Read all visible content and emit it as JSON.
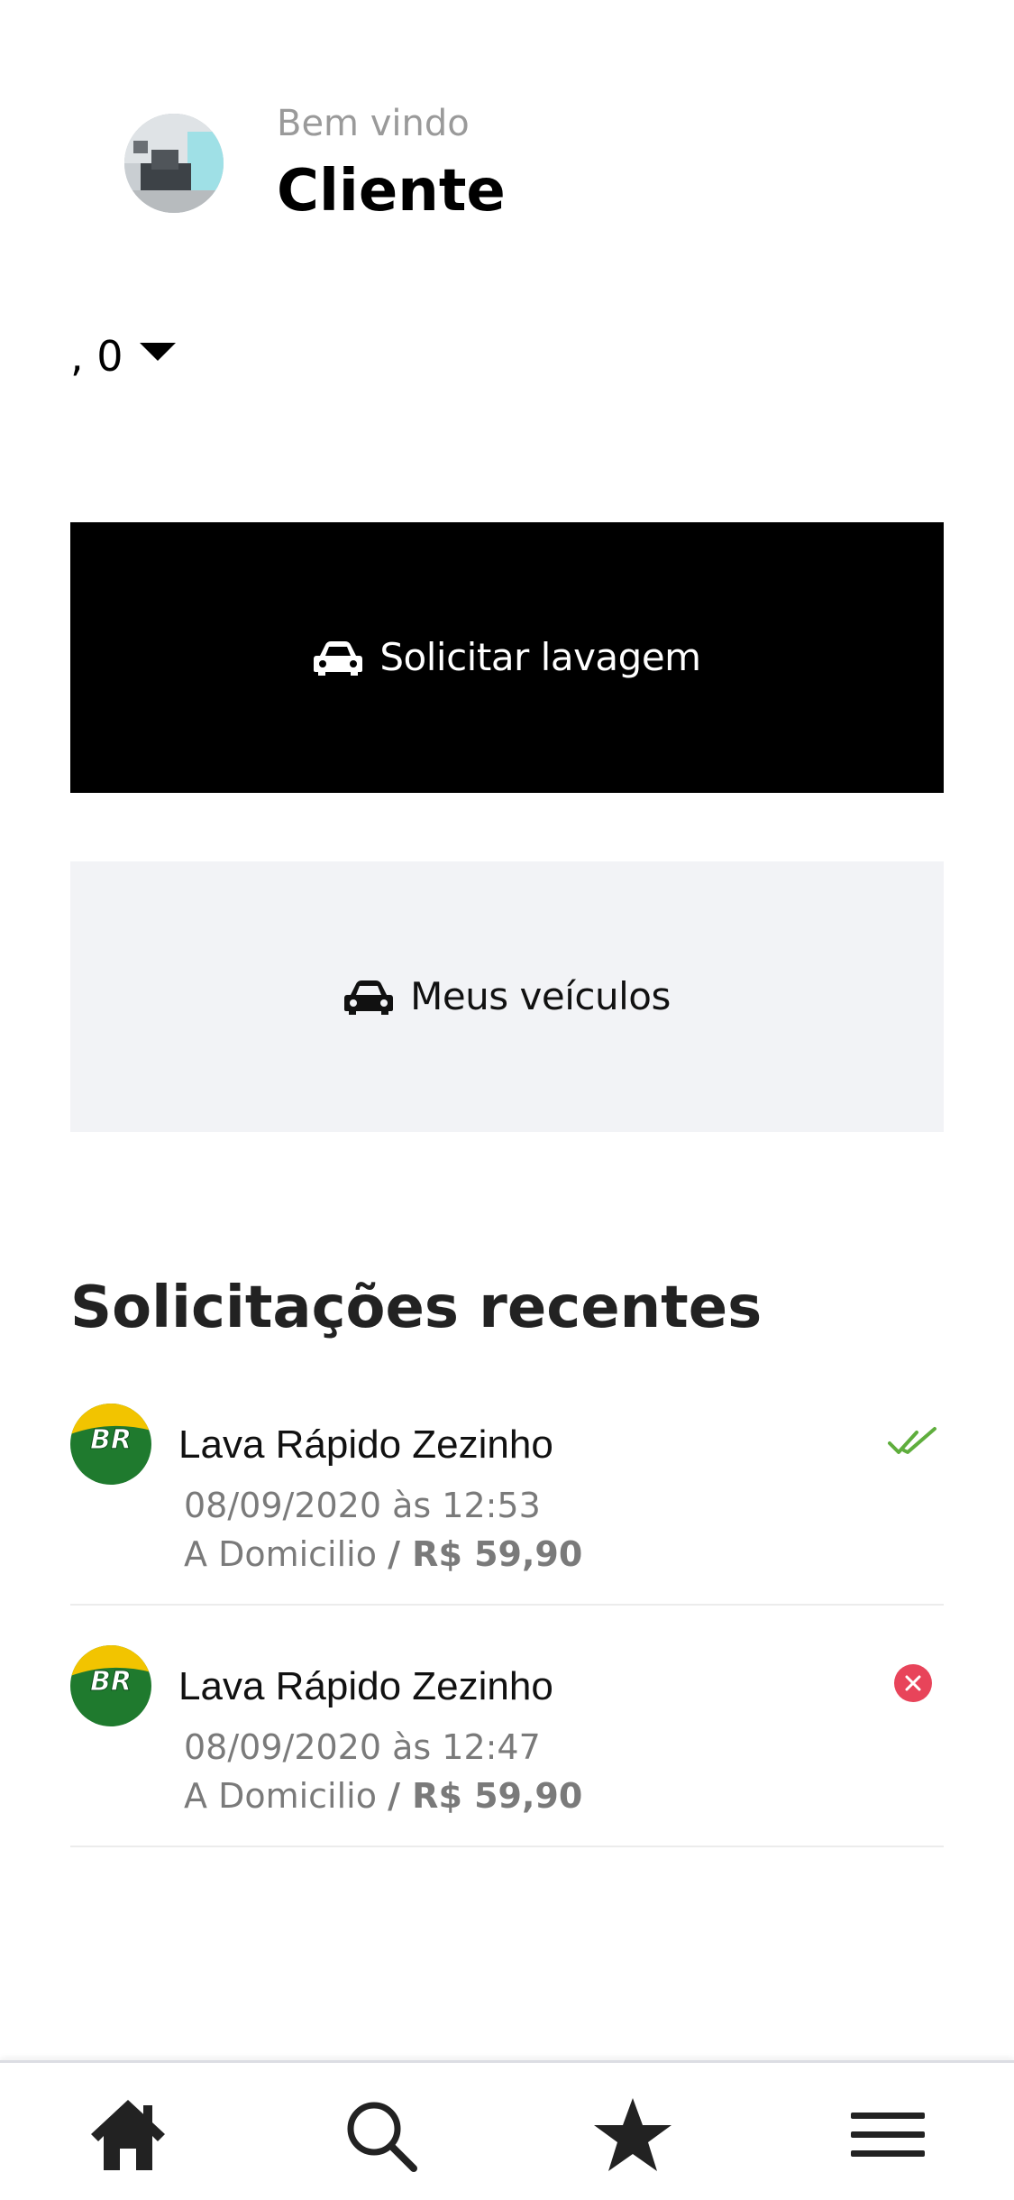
{
  "header": {
    "welcome_text": "Bem vindo",
    "user_name": "Cliente"
  },
  "selector": {
    "value": ", 0",
    "icon": "caret-down-icon"
  },
  "actions": {
    "request_wash": {
      "label": "Solicitar lavagem",
      "icon": "car-icon"
    },
    "my_vehicles": {
      "label": "Meus veículos",
      "icon": "car-icon"
    }
  },
  "recent": {
    "title": "Solicitações recentes",
    "items": [
      {
        "provider": "Lava Rápido Zezinho",
        "datetime": "08/09/2020 às 12:53",
        "service": "A Domicilio",
        "price": "/ R$ 59,90",
        "status_icon": "double-check-icon"
      },
      {
        "provider": "Lava Rápido Zezinho",
        "datetime": "08/09/2020 às 12:47",
        "service": "A Domicilio",
        "price": "/ R$ 59,90",
        "status_icon": "cancel-circle-icon"
      }
    ]
  },
  "logo_text": "BR",
  "colors": {
    "primary_button": "#000000",
    "secondary_button": "#f2f3f6",
    "success": "#5fae3d",
    "danger": "#e8445a"
  },
  "nav": {
    "items": [
      "home-icon",
      "search-icon",
      "star-icon",
      "menu-icon"
    ]
  }
}
